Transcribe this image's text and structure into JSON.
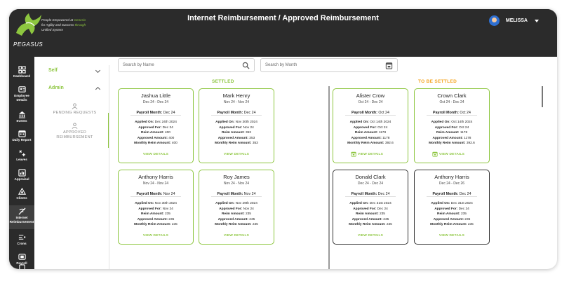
{
  "header": {
    "brand": "PEGASUS",
    "tagline_1": "People Empowered at ",
    "tagline_hl_1": "Genesis",
    "tagline_2": "for Agility and Success ",
    "tagline_hl_2": "through",
    "tagline_3": "Unified System",
    "title": "Internet Reimbursement / Approved Reimbursement",
    "user_name": "MELISSA"
  },
  "rail": [
    {
      "label": "Dashboard",
      "icon": "dashboard-icon"
    },
    {
      "label": "Employee Details",
      "icon": "employee-icon"
    },
    {
      "label": "Events",
      "icon": "events-icon"
    },
    {
      "label": "Daily Report",
      "icon": "report-icon"
    },
    {
      "label": "Leaves",
      "icon": "leaves-icon"
    },
    {
      "label": "Appraisal",
      "icon": "appraisal-icon"
    },
    {
      "label": "Clients",
      "icon": "clients-icon"
    },
    {
      "label": "Internet Reimbursement",
      "icon": "wifi-icon"
    },
    {
      "label": "Crons",
      "icon": "crons-icon"
    },
    {
      "label": "Payroll",
      "icon": "payroll-icon"
    }
  ],
  "submenu": {
    "self": "Self",
    "admin": "Admin",
    "pending": "PENDING REQUESTS",
    "approved": "APPROVED REIMBURSEMENT"
  },
  "search": {
    "name_placeholder": "Search by Name",
    "month_placeholder": "Search by Month"
  },
  "sections": {
    "settled": "SETTLED",
    "to_be_settled": "TO BE SETTLED"
  },
  "labels": {
    "payroll_month": "Payroll Month:",
    "applied_on": "Applied On:",
    "approved_for": "Approved For:",
    "reim_amount": "Reim Amount:",
    "approved_amount": "Approved Amount:",
    "monthly_reim": "Monthly Reim Amount:",
    "view_details": "VIEW DETAILS"
  },
  "cards": [
    {
      "name": "Jashua Little",
      "range": "Dec 24 - Dec 24",
      "payroll": "Dec 24",
      "applied_on": "Dec 24th 2024",
      "approved_for": "Dec 24",
      "reim": "400",
      "approved": "400",
      "monthly": "400"
    },
    {
      "name": "Mark Henry",
      "range": "Nov 24 - Nov 24",
      "payroll": "Dec 24",
      "applied_on": "Nov 30th 2024",
      "approved_for": "Nov 24",
      "reim": "353",
      "approved": "353",
      "monthly": "353"
    },
    {
      "name": "Alister Crow",
      "range": "Oct 24 - Dec 24",
      "payroll": "Oct 24",
      "applied_on": "Oct 14th 2024",
      "approved_for": "Oct 24",
      "reim": "1178",
      "approved": "1178",
      "monthly": "392.6"
    },
    {
      "name": "Crown Clark",
      "range": "Oct 24 - Dec 24",
      "payroll": "Oct 24",
      "applied_on": "Oct 14th 2024",
      "approved_for": "Oct 24",
      "reim": "1178",
      "approved": "1178",
      "monthly": "392.6"
    },
    {
      "name": "Anthony Harris",
      "range": "Nov 24 - Nov 24",
      "payroll": "Nov 24",
      "applied_on": "Nov 30th 2024",
      "approved_for": "Nov 24",
      "reim": "235",
      "approved": "235",
      "monthly": "235"
    },
    {
      "name": "Roy James",
      "range": "Nov 24 - Nov 24",
      "payroll": "Nov 24",
      "applied_on": "Nov 29th 2024",
      "approved_for": "Nov 24",
      "reim": "235",
      "approved": "235",
      "monthly": "235"
    },
    {
      "name": "Donald Clark",
      "range": "Dec 24 - Dec 24",
      "payroll": "Dec 24",
      "applied_on": "Dec 31st 2024",
      "approved_for": "Dec 24",
      "reim": "235",
      "approved": "235",
      "monthly": "235"
    },
    {
      "name": "Anthony Harris",
      "range": "Dec 24 - Dec 26",
      "payroll": "Dec 24",
      "applied_on": "Dec 31st 2024",
      "approved_for": "Dec 24",
      "reim": "235",
      "approved": "235",
      "monthly": "235"
    }
  ],
  "colors": {
    "accent": "#8dc63f",
    "pending": "#f5a623",
    "dark": "#2b2b2b"
  }
}
